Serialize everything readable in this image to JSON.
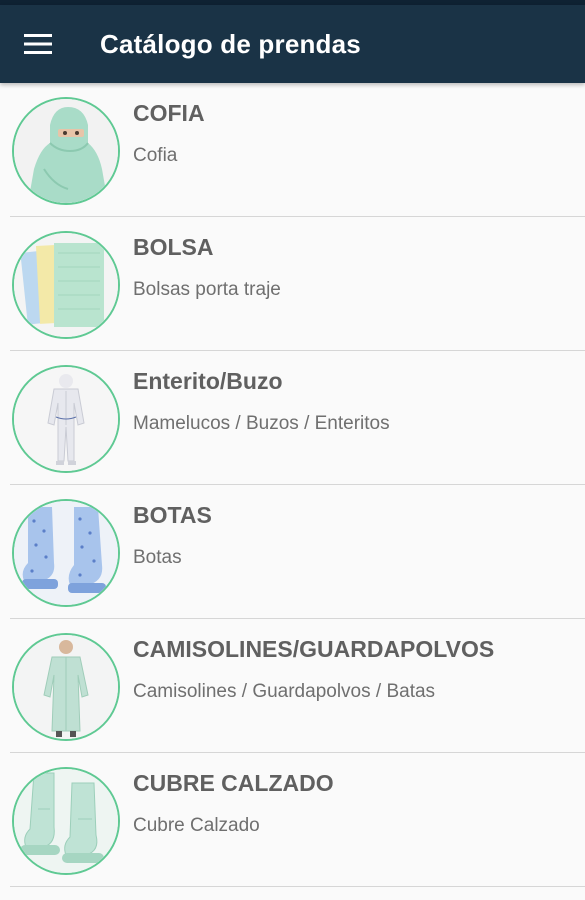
{
  "app_bar": {
    "menu_icon": "hamburger-menu-icon",
    "title": "Catálogo de prendas",
    "background": "#1a3346"
  },
  "accent_color": "#5fc993",
  "items": [
    {
      "title": "COFIA",
      "subtitle": "Cofia",
      "image": "hood-garment"
    },
    {
      "title": "BOLSA",
      "subtitle": "Bolsas porta traje",
      "image": "garment-bags"
    },
    {
      "title": "Enterito/Buzo",
      "subtitle": "Mamelucos / Buzos / Enteritos",
      "image": "coverall-suit"
    },
    {
      "title": "BOTAS",
      "subtitle": "Botas",
      "image": "boots"
    },
    {
      "title": "CAMISOLINES/GUARDAPOLVOS",
      "subtitle": "Camisolines / Guardapolvos / Batas",
      "image": "gown"
    },
    {
      "title": "CUBRE CALZADO",
      "subtitle": "Cubre Calzado",
      "image": "shoe-covers"
    }
  ]
}
